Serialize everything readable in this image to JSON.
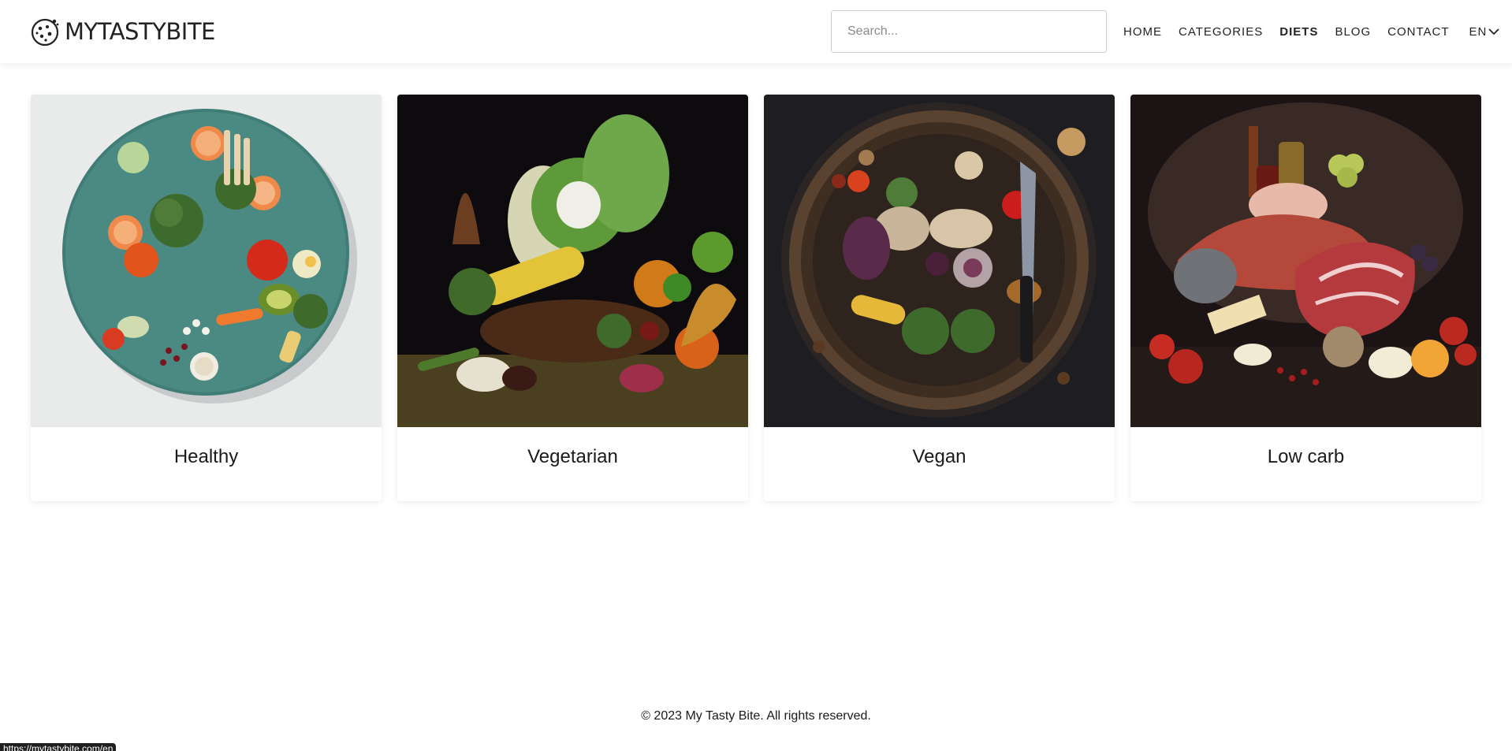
{
  "header": {
    "logo_text": "MYTASTYBITE",
    "search_placeholder": "Search...",
    "nav": [
      {
        "label": "HOME"
      },
      {
        "label": "CATEGORIES"
      },
      {
        "label": "DIETS"
      },
      {
        "label": "BLOG"
      },
      {
        "label": "CONTACT"
      }
    ],
    "language": "EN",
    "active_nav": "DIETS"
  },
  "cards": [
    {
      "title": "Healthy",
      "image": "healthy-food-plate"
    },
    {
      "title": "Vegetarian",
      "image": "vegetarian-vegetables-spread"
    },
    {
      "title": "Vegan",
      "image": "vegan-plate-with-knife"
    },
    {
      "title": "Low carb",
      "image": "low-carb-meat-and-cheese"
    }
  ],
  "footer": {
    "copyright": "© 2023 My Tasty Bite. All rights reserved."
  },
  "status_bar": {
    "url": "https://mytastybite.com/en"
  }
}
